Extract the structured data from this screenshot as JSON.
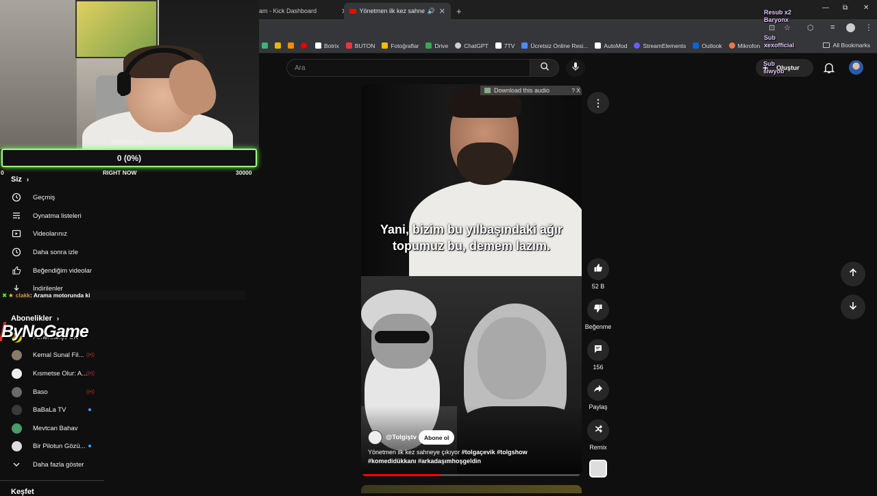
{
  "browser": {
    "tabs": [
      {
        "label": "am - Kick Dashboard"
      },
      {
        "label": "Yönetmen ilk kez sahneye ç"
      }
    ],
    "new_tab": "+",
    "bookmarks": [
      {
        "label": "Botrix",
        "color": "#ffffff"
      },
      {
        "label": "BUTON",
        "color": "#e53935"
      },
      {
        "label": "Fotoğraflar",
        "color": "#fbbc04"
      },
      {
        "label": "Drive",
        "color": "#34a853"
      },
      {
        "label": "ChatGPT",
        "color": "#d0d0d0"
      },
      {
        "label": "7TV",
        "color": "#ffffff"
      },
      {
        "label": "Ücretsiz Online Resi...",
        "color": "#4a8cff"
      },
      {
        "label": "AutoMod",
        "color": "#ffffff"
      },
      {
        "label": "StreamElements",
        "color": "#6a5cff"
      },
      {
        "label": "Outlook",
        "color": "#0a64d6"
      },
      {
        "label": "Mikrofon",
        "color": "#e87a45"
      }
    ],
    "all_bookmarks": "All Bookmarks",
    "more_bookmarks": "»"
  },
  "overlay": {
    "goal_title": "EKIPMAN",
    "goal_value": "0 (0%)",
    "goal_min": "0",
    "goal_now": "RIGHT NOW",
    "goal_max": "30000",
    "goal_progress": 0,
    "chat_user": "clakk",
    "chat_message": ": Arama motorunda ki",
    "brand": "ByNoGame",
    "alerts": [
      "Resub x2",
      "Baryonx",
      "Sub",
      "xexofficial",
      "Sub",
      "siwyob"
    ]
  },
  "sidebar": {
    "you_title": "Siz",
    "you_items": [
      {
        "label": "Geçmiş",
        "icon": "history-icon"
      },
      {
        "label": "Oynatma listeleri",
        "icon": "playlist-icon"
      },
      {
        "label": "Videolarınız",
        "icon": "your-videos-icon"
      },
      {
        "label": "Daha sonra izle",
        "icon": "watch-later-icon"
      },
      {
        "label": "Beğendiğim videolar",
        "icon": "liked-icon"
      },
      {
        "label": "İndirilenler",
        "icon": "download-icon"
      }
    ],
    "subs_title": "Abonelikler",
    "subs": [
      {
        "label": "Fenerbahçe SK",
        "avatar_color": "#f2d400",
        "status": "none"
      },
      {
        "label": "Kemal Sunal Fil...",
        "avatar_color": "#8a7a6a",
        "status": "live"
      },
      {
        "label": "Kısmetse Olur: A...",
        "avatar_color": "#f0f0f0",
        "status": "live"
      },
      {
        "label": "Baso",
        "avatar_color": "#6a6a6a",
        "status": "live"
      },
      {
        "label": "BaBaLa TV",
        "avatar_color": "#3a3a3a",
        "status": "dot"
      },
      {
        "label": "Mevtcan Bahav",
        "avatar_color": "#4a9a6a",
        "status": "none"
      },
      {
        "label": "Bir Pilotun Gözü...",
        "avatar_color": "#dddddd",
        "status": "dot"
      }
    ],
    "show_more": "Daha fazla göster",
    "explore_title": "Keşfet"
  },
  "masthead": {
    "search_placeholder": "Ara",
    "create_label": "Oluştur"
  },
  "short": {
    "subtitle": "Yani, bizim bu yılbaşındaki ağır topumuz bu, demem lazım.",
    "download_audio": "Download this audio",
    "download_help": "?",
    "download_close": "X",
    "channel": "@Tolgiştv",
    "subscribe_label": "Abone ol",
    "title_text": "Yönetmen ilk kez sahneye çıkıyor",
    "hashtags_1": "#tolgaçevik #tolgshow",
    "hashtags_2": "#komedidükkanı #arkadaşımhoşgeldin",
    "progress": 0.36,
    "likes": "52 B",
    "dislike_label": "Beğenme",
    "comments": "156",
    "share_label": "Paylaş",
    "remix_label": "Remix"
  }
}
